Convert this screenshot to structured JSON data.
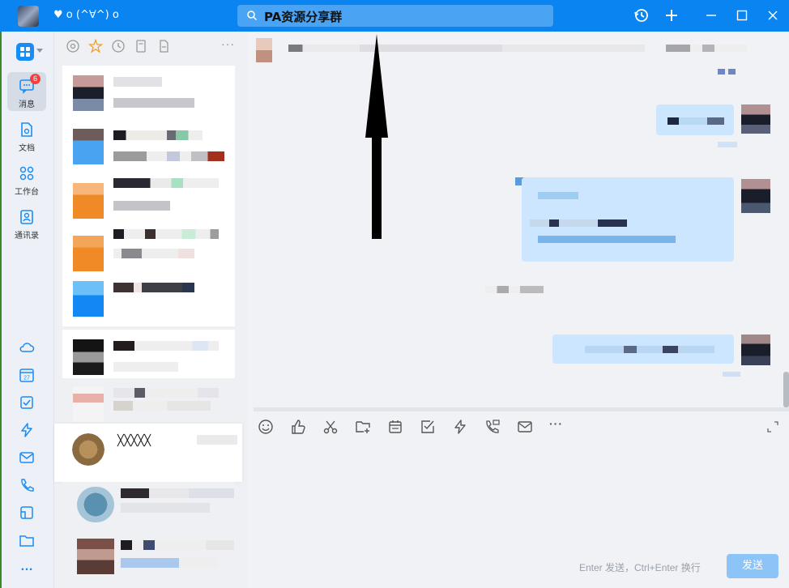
{
  "titlebar": {
    "nickname": "♥ o (^∀^) o",
    "search_text": "PA资源分享群",
    "accent": "#0a84f0"
  },
  "nav": {
    "items": [
      {
        "label": "消息",
        "icon": "chat-bubble-icon",
        "badge": "6"
      },
      {
        "label": "文档",
        "icon": "document-icon"
      },
      {
        "label": "工作台",
        "icon": "workbench-icon"
      },
      {
        "label": "通讯录",
        "icon": "contacts-icon"
      }
    ],
    "bottom_icons": [
      "cloud-icon",
      "calendar-icon",
      "todo-check-icon",
      "lightning-icon",
      "mail-icon",
      "phone-icon",
      "box-icon",
      "folder-icon",
      "more-icon"
    ],
    "calendar_day": "27",
    "more": "…"
  },
  "conversations": {
    "tabs": [
      "at-icon",
      "star-icon",
      "clock-icon",
      "doc-icon",
      "file-icon"
    ],
    "more": "···",
    "selected_name": "╳╳╳╳╳"
  },
  "toolbar": {
    "tools": [
      "emoji-icon",
      "thumbs-up-icon",
      "scissors-icon",
      "folder-add-icon",
      "schedule-icon",
      "task-check-icon",
      "lightning-icon",
      "phone-icon",
      "mail-icon",
      "more-icon"
    ],
    "more": "···"
  },
  "input": {
    "hint": "Enter 发送，Ctrl+Enter 换行",
    "send_label": "发送"
  }
}
